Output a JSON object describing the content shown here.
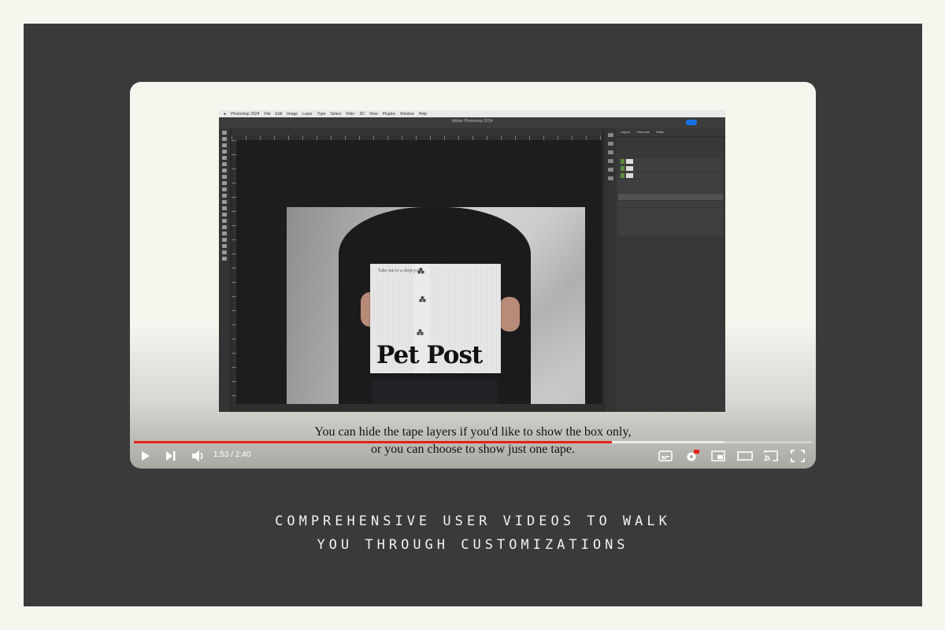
{
  "player": {
    "caption_line1": "You can hide the tape layers if you'd like to show the box only,",
    "caption_line2": "or you can choose to show just one tape.",
    "time_display": "1:53 / 2:40",
    "progress_played": 0.705,
    "progress_buffered": 0.87
  },
  "photoshop": {
    "app_name": "Photoshop 2024",
    "menu": [
      "File",
      "Edit",
      "Image",
      "Layer",
      "Type",
      "Select",
      "Filter",
      "3D",
      "View",
      "Plugins",
      "Window",
      "Help"
    ],
    "window_title": "Adobe Photoshop 2024",
    "panel_tabs": [
      "Layers",
      "Channels",
      "Paths"
    ]
  },
  "box": {
    "tagline": "Take me to a shop pets.",
    "brand": "Pet Post"
  },
  "footer": {
    "line1": "COMPREHENSIVE USER VIDEOS TO WALK",
    "line2": "YOU THROUGH CUSTOMIZATIONS"
  },
  "colors": {
    "frame": "#3a3a3a",
    "progress_played": "#e62117",
    "background": "#f6f5ee"
  }
}
